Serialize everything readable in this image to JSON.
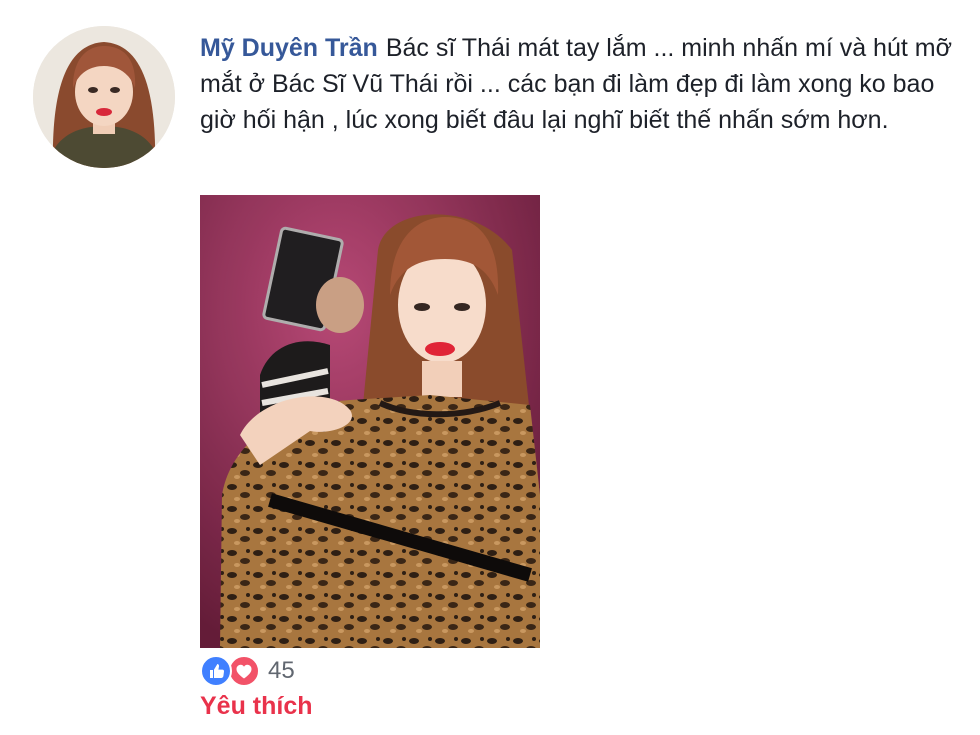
{
  "post": {
    "author_name": "Mỹ Duyên Trần",
    "text": "Bác sĩ Thái mát tay lắm ... minh nhấn mí và hút mỡ mắt ở Bác Sĩ Vũ Thái rồi ... các bạn đi làm đẹp đi làm xong ko bao giờ hối hận , lúc xong biết đâu lại nghĩ biết thế nhấn sớm hơn."
  },
  "reactions": {
    "icons": [
      "like-icon",
      "love-icon"
    ],
    "count": "45",
    "like_color": "#4080ff",
    "love_color": "#f25268"
  },
  "actions": {
    "like_label": "Yêu thích",
    "like_color": "#e9324b"
  },
  "colors": {
    "author": "#365899",
    "text": "#1d2129"
  }
}
